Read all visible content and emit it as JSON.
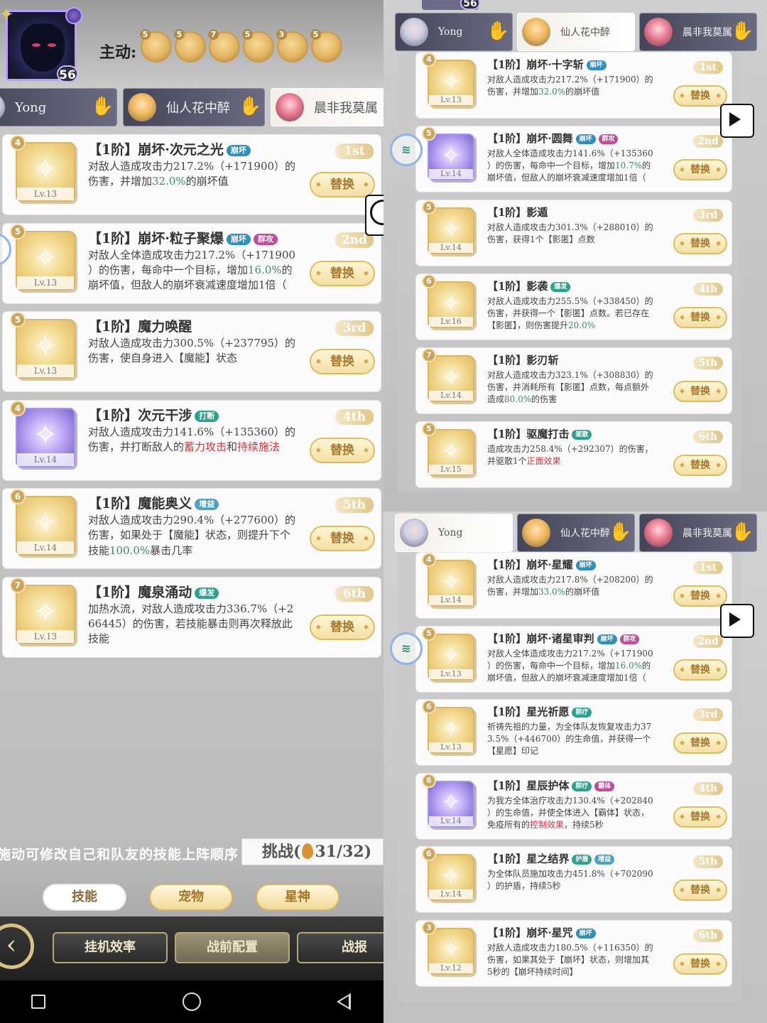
{
  "left": {
    "player_level": "56",
    "active_label": "主动:",
    "coins": [
      "5",
      "5",
      "7",
      "5",
      "3",
      "5"
    ],
    "tabs": [
      {
        "name": "Yong",
        "active": false
      },
      {
        "name": "仙人花中醉",
        "active": false
      },
      {
        "name": "晨非我莫属",
        "active": true
      }
    ],
    "skills": [
      {
        "num": "4",
        "level": "Lv.13",
        "name": "【1阶】崩坏·次元之光",
        "tags": [
          {
            "t": "崩坏",
            "c": "blue"
          }
        ],
        "rank": "1st",
        "desc": [
          "对敌人造成攻击力217.2%（+171900）的",
          "伤害，并增加32.0%的崩坏值"
        ],
        "icon": "purple_no"
      },
      {
        "num": "5",
        "level": "Lv.13",
        "name": "【1阶】崩坏·粒子聚爆",
        "tags": [
          {
            "t": "崩坏",
            "c": "blue"
          },
          {
            "t": "群攻",
            "c": "pink"
          }
        ],
        "rank": "2nd",
        "desc": [
          "对敌人全体造成攻击力217.2%（+171900",
          "）的伤害，每命中一个目标，增加16.0%的",
          "崩坏值，但敌人的崩坏衰减速度增加1倍（"
        ]
      },
      {
        "num": "5",
        "level": "Lv.13",
        "name": "【1阶】魔力唤醒",
        "tags": [],
        "rank": "3rd",
        "desc": [
          "对敌人造成攻击力300.5%（+237795）的",
          "伤害，使自身进入【魔能】状态"
        ]
      },
      {
        "num": "4",
        "level": "Lv.14",
        "name": "【1阶】次元干涉",
        "tags": [
          {
            "t": "打断",
            "c": "teal"
          }
        ],
        "rank": "4th",
        "desc": [
          "对敌人造成攻击力141.6%（+135360）的",
          "伤害，并打断敌人的蓄力攻击和持续施法"
        ],
        "icon": "purple"
      },
      {
        "num": "6",
        "level": "Lv.14",
        "name": "【1阶】魔能奥义",
        "tags": [
          {
            "t": "增益",
            "c": "gold"
          }
        ],
        "rank": "5th",
        "desc": [
          "对敌人造成攻击力290.4%（+277600）的",
          "伤害，如果处于【魔能】状态，则提升下个",
          "技能100.0%暴击几率"
        ]
      },
      {
        "num": "7",
        "level": "Lv.13",
        "name": "【1阶】魔泉涌动",
        "tags": [
          {
            "t": "爆发",
            "c": "teal"
          }
        ],
        "rank": "6th",
        "desc": [
          "加热水流，对敌人造成攻击力336.7%（+2",
          "66445）的伤害，若技能暴击则再次释放此",
          "技能"
        ]
      }
    ],
    "replace_label": "替换",
    "hint_text": "施动可修改自己和队友的技能上阵顺序",
    "challenge_label": "挑战(",
    "challenge_count": "31/32)",
    "bottom_tabs": [
      "技能",
      "宠物",
      "星神"
    ],
    "bottom_buttons": [
      "挂机效率",
      "战前配置",
      "战报"
    ]
  },
  "right_top": {
    "level_badge": "56",
    "tabs": [
      {
        "name": "Yong",
        "active": false
      },
      {
        "name": "仙人花中醉",
        "active": true
      },
      {
        "name": "晨非我莫属",
        "active": false
      }
    ],
    "skills": [
      {
        "num": "4",
        "level": "Lv.13",
        "name": "【1阶】崩坏·十字斩",
        "tags": [
          {
            "t": "崩坏",
            "c": "blue"
          }
        ],
        "rank": "1st",
        "desc": [
          "对敌人造成攻击力217.2%（+171900）的",
          "伤害，并增加32.0%的崩坏值"
        ]
      },
      {
        "num": "5",
        "level": "Lv.14",
        "name": "【1阶】崩坏·圆舞",
        "tags": [
          {
            "t": "崩坏",
            "c": "blue"
          },
          {
            "t": "群攻",
            "c": "pink"
          }
        ],
        "rank": "2nd",
        "desc": [
          "对敌人全体造成攻击力141.6%（+135360",
          "）的伤害，每命中一个目标，增加10.7%的",
          "崩坏值，但敌人的崩坏衰减速度增加1倍（"
        ],
        "icon": "purple"
      },
      {
        "num": "5",
        "level": "Lv.14",
        "name": "【1阶】影遁",
        "tags": [],
        "rank": "3rd",
        "desc": [
          "对敌人造成攻击力301.3%（+288010）的",
          "伤害，获得1个【影匿】点数"
        ]
      },
      {
        "num": "6",
        "level": "Lv.16",
        "name": "【1阶】影袭",
        "tags": [
          {
            "t": "爆发",
            "c": "teal"
          }
        ],
        "rank": "4th",
        "desc": [
          "对敌人造成攻击力255.5%（+338450）的",
          "伤害，并获得一个【影匿】点数。若已存在",
          "【影匿】，则伤害提升20.0%"
        ]
      },
      {
        "num": "7",
        "level": "Lv.14",
        "name": "【1阶】影刃斩",
        "tags": [],
        "rank": "5th",
        "desc": [
          "对敌人造成攻击力323.1%（+308830）的",
          "伤害，并消耗所有【影匿】点数，每点额外",
          "造成80.0%的伤害"
        ]
      },
      {
        "num": "5",
        "level": "Lv.15",
        "name": "【1阶】驱魔打击",
        "tags": [
          {
            "t": "驱散",
            "c": "teal"
          }
        ],
        "rank": "6th",
        "desc": [
          "造成攻击力258.4%（+292307）的伤害，",
          "并驱散1个正面效果"
        ]
      }
    ]
  },
  "right_bottom": {
    "tabs": [
      {
        "name": "Yong",
        "active": true
      },
      {
        "name": "仙人花中醉",
        "active": false
      },
      {
        "name": "晨非我莫属",
        "active": false
      }
    ],
    "skills": [
      {
        "num": "4",
        "level": "Lv.14",
        "name": "【1阶】崩坏·星耀",
        "tags": [
          {
            "t": "崩坏",
            "c": "blue"
          }
        ],
        "rank": "1st",
        "desc": [
          "对敌人造成攻击力217.8%（+208200）的",
          "伤害，并增加33.0%的崩坏值"
        ]
      },
      {
        "num": "5",
        "level": "Lv.13",
        "name": "【1阶】崩坏·诸星审判",
        "tags": [
          {
            "t": "崩坏",
            "c": "blue"
          },
          {
            "t": "群攻",
            "c": "pink"
          }
        ],
        "rank": "2nd",
        "desc": [
          "对敌人全体造成攻击力217.2%（+171900",
          "）的伤害，每命中一个目标，增加16.0%的",
          "崩坏值，但敌人的崩坏衰减速度增加1倍（"
        ]
      },
      {
        "num": "6",
        "level": "Lv.13",
        "name": "【1阶】星光祈愿",
        "tags": [
          {
            "t": "群疗",
            "c": "teal"
          }
        ],
        "rank": "3rd",
        "desc": [
          "祈祷先祖的力量，为全体队友恢复攻击力37",
          "3.5%（+446700）的生命值，并获得一个",
          "【星愿】印记"
        ]
      },
      {
        "num": "6",
        "level": "Lv.14",
        "name": "【1阶】星辰护体",
        "tags": [
          {
            "t": "群疗",
            "c": "teal"
          },
          {
            "t": "霸体",
            "c": "pink"
          }
        ],
        "rank": "4th",
        "desc": [
          "为我方全体治疗攻击力130.4%（+202840",
          "）的生命值，并使全体进入【霸体】状态，",
          "免疫所有的控制效果，持续5秒"
        ],
        "icon": "purple"
      },
      {
        "num": "6",
        "level": "Lv.14",
        "name": "【1阶】星之结界",
        "tags": [
          {
            "t": "护盾",
            "c": "teal"
          },
          {
            "t": "增益",
            "c": "gold"
          }
        ],
        "rank": "5th",
        "desc": [
          "为全体队员施加攻击力451.8%（+702090",
          "）的护盾，持续5秒"
        ]
      },
      {
        "num": "3",
        "level": "Lv.12",
        "name": "【1阶】崩坏·星咒",
        "tags": [
          {
            "t": "崩坏",
            "c": "blue"
          }
        ],
        "rank": "6th",
        "desc": [
          "对敌人造成攻击力180.5%（+116350）的",
          "伤害，如果其处于【崩坏】状态，则增加其",
          "5秒的【崩坏持续时间】"
        ]
      }
    ]
  }
}
